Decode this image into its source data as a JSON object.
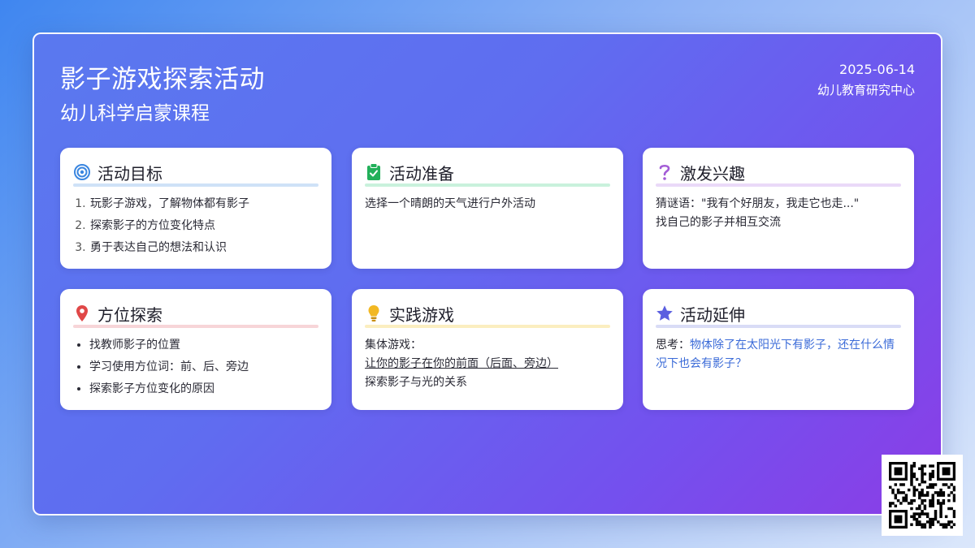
{
  "header": {
    "title": "影子游戏探索活动",
    "subtitle": "幼儿科学启蒙课程",
    "date": "2025-06-14",
    "organization": "幼儿教育研究中心"
  },
  "cards": [
    {
      "title": "活动目标",
      "icon": "target-icon",
      "accent": "#cfe2f7",
      "items": [
        "玩影子游戏，了解物体都有影子",
        "探索影子的方位变化特点",
        "勇于表达自己的想法和认识"
      ]
    },
    {
      "title": "活动准备",
      "icon": "clipboard-check-icon",
      "accent": "#c9f1dc",
      "lines": [
        "选择一个晴朗的天气进行户外活动"
      ]
    },
    {
      "title": "激发兴趣",
      "icon": "question-icon",
      "accent": "#ead9f8",
      "lines": [
        "猜谜语：\"我有个好朋友，我走它也走...\"",
        "找自己的影子并相互交流"
      ]
    },
    {
      "title": "方位探索",
      "icon": "location-pin-icon",
      "accent": "#f7d5d8",
      "items": [
        "找教师影子的位置",
        "学习使用方位词：前、后、旁边",
        "探索影子方位变化的原因"
      ]
    },
    {
      "title": "实践游戏",
      "icon": "lightbulb-icon",
      "accent": "#fbeec0",
      "game_prefix": "集体游戏：",
      "game_text": "让你的影子在你的前面（后面、旁边）",
      "line2": "探索影子与光的关系"
    },
    {
      "title": "活动延伸",
      "icon": "star-icon",
      "accent": "#d9dcf6",
      "think_prefix": "思考：",
      "think_text": "物体除了在太阳光下有影子，还在什么情况下也会有影子？"
    }
  ],
  "colors": {
    "accent_blue": "#3b6bd8",
    "target_blue": "#3a86e0",
    "check_green": "#22b05a",
    "question_purple": "#a35cd6",
    "pin_red": "#e04848",
    "bulb_yellow": "#f2b823",
    "star_indigo": "#5b5fe0"
  }
}
